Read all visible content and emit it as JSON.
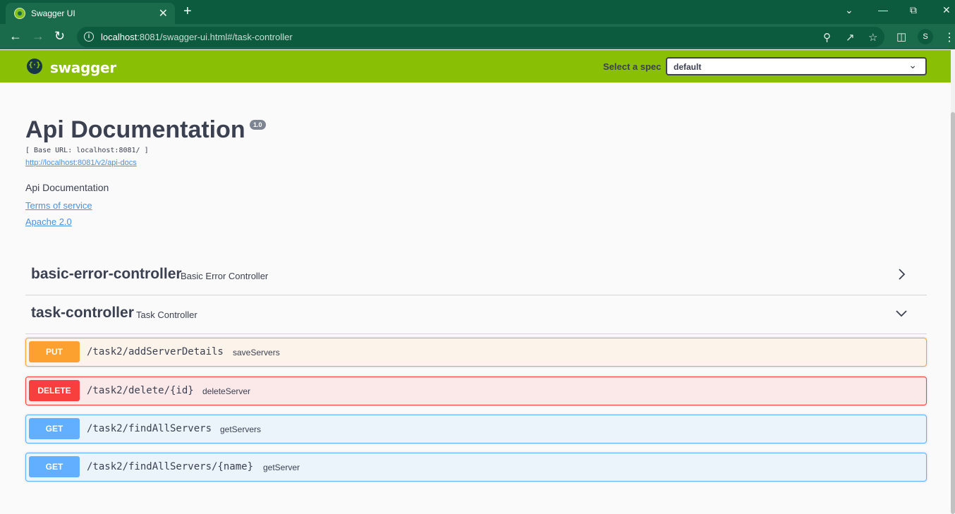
{
  "browser": {
    "tab_title": "Swagger UI",
    "tab_close": "✕",
    "new_tab": "+",
    "url_host": "localhost",
    "url_rest": ":8081/swagger-ui.html#/task-controller",
    "profile_initial": "S"
  },
  "topbar": {
    "logo_text": "swagger",
    "spec_label": "Select a spec",
    "spec_value": "default"
  },
  "info": {
    "title": "Api Documentation",
    "version": "1.0",
    "base_url": "[ Base URL: localhost:8081/ ]",
    "api_docs_link": "http://localhost:8081/v2/api-docs",
    "description": "Api Documentation",
    "terms_link": "Terms of service",
    "license_link": "Apache 2.0"
  },
  "tags": [
    {
      "name": "basic-error-controller",
      "description": "Basic Error Controller",
      "expanded": false
    },
    {
      "name": "task-controller",
      "description": "Task Controller",
      "expanded": true
    }
  ],
  "operations": [
    {
      "method": "PUT",
      "path": "/task2/addServerDetails",
      "summary": "saveServers",
      "color": "#fca130"
    },
    {
      "method": "DELETE",
      "path": "/task2/delete/{id}",
      "summary": "deleteServer",
      "color": "#f93e3e"
    },
    {
      "method": "GET",
      "path": "/task2/findAllServers",
      "summary": "getServers",
      "color": "#61affe"
    },
    {
      "method": "GET",
      "path": "/task2/findAllServers/{name}",
      "summary": "getServer",
      "color": "#61affe"
    }
  ],
  "colors": {
    "topbar": "#89bf04",
    "chrome_dark": "#0d5b3f",
    "chrome": "#1a6b4c",
    "text": "#3b4151",
    "link": "#4990e2"
  },
  "icons": [
    "swagger-favicon-icon",
    "close-icon",
    "plus-icon",
    "back-arrow-icon",
    "forward-arrow-icon",
    "reload-icon",
    "info-icon",
    "zoom-icon",
    "share-icon",
    "star-icon",
    "side-panel-icon",
    "kebab-menu-icon",
    "chevron-down-icon",
    "chevron-right-icon"
  ]
}
